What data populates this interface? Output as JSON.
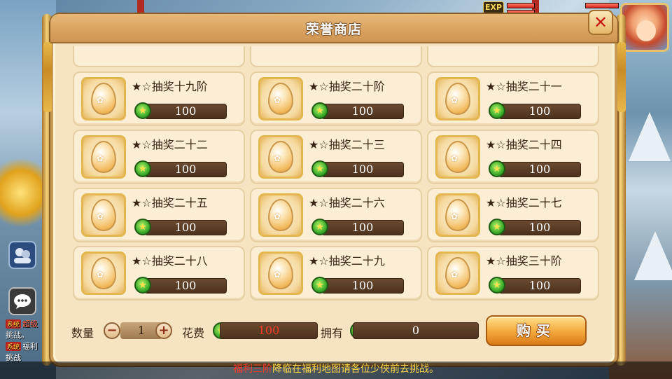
{
  "window": {
    "title": "荣誉商店",
    "close_symbol": "✕"
  },
  "hud": {
    "exp_label": "EXP"
  },
  "shop": {
    "items": [
      {
        "name": "★☆抽奖十九阶",
        "price": "100"
      },
      {
        "name": "★☆抽奖二十阶",
        "price": "100"
      },
      {
        "name": "★☆抽奖二十一",
        "price": "100"
      },
      {
        "name": "★☆抽奖二十二",
        "price": "100"
      },
      {
        "name": "★☆抽奖二十三",
        "price": "100"
      },
      {
        "name": "★☆抽奖二十四",
        "price": "100"
      },
      {
        "name": "★☆抽奖二十五",
        "price": "100"
      },
      {
        "name": "★☆抽奖二十六",
        "price": "100"
      },
      {
        "name": "★☆抽奖二十七",
        "price": "100"
      },
      {
        "name": "★☆抽奖二十八",
        "price": "100"
      },
      {
        "name": "★☆抽奖二十九",
        "price": "100"
      },
      {
        "name": "★☆抽奖三十阶",
        "price": "100"
      }
    ]
  },
  "purchase": {
    "quantity_label": "数量",
    "quantity_value": "1",
    "decrement_symbol": "−",
    "increment_symbol": "+",
    "cost_label": "花费",
    "cost_value": "100",
    "owned_label": "拥有",
    "owned_value": "0",
    "buy_label": "购买"
  },
  "chat": {
    "lines": [
      {
        "tag": "系统",
        "text": "超级"
      },
      {
        "tag": "",
        "text": "挑战。"
      },
      {
        "tag": "系统",
        "text": "福利"
      },
      {
        "tag": "",
        "text": "挑战"
      }
    ],
    "side_fragment": "坛"
  },
  "ticker": {
    "prefix": "福利三阶",
    "message": "降临在福利地图请各位少侠前去挑战。"
  },
  "icons": {
    "item_icon": "egg-icon",
    "currency_icon": "honor-coin-icon",
    "close_icon": "close-icon",
    "friends_icon": "friends-icon",
    "chat_icon": "chat-bubble-icon"
  },
  "colors": {
    "panel_bg": "#f5e3c1",
    "title_bar": "#cf9350",
    "price_bar": "#4b321e",
    "cost_text": "#ff3a2a",
    "buy_button": "#f3a63a"
  }
}
